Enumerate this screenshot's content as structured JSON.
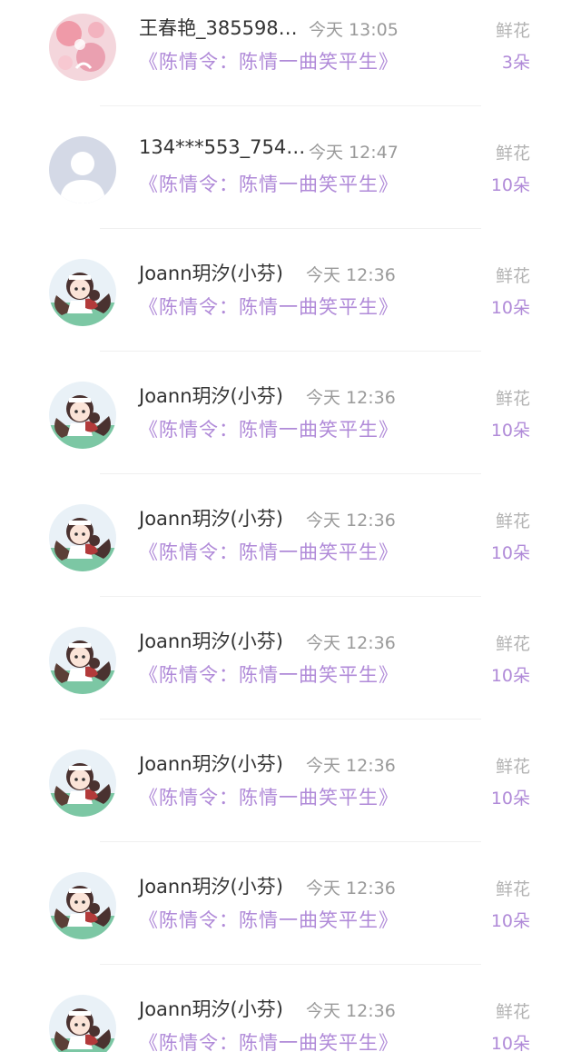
{
  "records": [
    {
      "user": "王春艳_385598…",
      "time": "今天 13:05",
      "book": "《陈情令：陈情一曲笑平生》",
      "gift": "鲜花",
      "count": "3朵",
      "avatar": "pink-floral-avatar"
    },
    {
      "user": "134***553_754…",
      "time": "今天 12:47",
      "book": "《陈情令：陈情一曲笑平生》",
      "gift": "鲜花",
      "count": "10朵",
      "avatar": "default-user-avatar"
    },
    {
      "user": "Joann玥汐(小芬)",
      "time": "今天 12:36",
      "book": "《陈情令：陈情一曲笑平生》",
      "gift": "鲜花",
      "count": "10朵",
      "avatar": "anime-character-avatar"
    },
    {
      "user": "Joann玥汐(小芬)",
      "time": "今天 12:36",
      "book": "《陈情令：陈情一曲笑平生》",
      "gift": "鲜花",
      "count": "10朵",
      "avatar": "anime-character-avatar"
    },
    {
      "user": "Joann玥汐(小芬)",
      "time": "今天 12:36",
      "book": "《陈情令：陈情一曲笑平生》",
      "gift": "鲜花",
      "count": "10朵",
      "avatar": "anime-character-avatar"
    },
    {
      "user": "Joann玥汐(小芬)",
      "time": "今天 12:36",
      "book": "《陈情令：陈情一曲笑平生》",
      "gift": "鲜花",
      "count": "10朵",
      "avatar": "anime-character-avatar"
    },
    {
      "user": "Joann玥汐(小芬)",
      "time": "今天 12:36",
      "book": "《陈情令：陈情一曲笑平生》",
      "gift": "鲜花",
      "count": "10朵",
      "avatar": "anime-character-avatar"
    },
    {
      "user": "Joann玥汐(小芬)",
      "time": "今天 12:36",
      "book": "《陈情令：陈情一曲笑平生》",
      "gift": "鲜花",
      "count": "10朵",
      "avatar": "anime-character-avatar"
    },
    {
      "user": "Joann玥汐(小芬)",
      "time": "今天 12:36",
      "book": "《陈情令：陈情一曲笑平生》",
      "gift": "鲜花",
      "count": "10朵",
      "avatar": "anime-character-avatar"
    }
  ],
  "colors": {
    "accent_purple": "#b08ad8",
    "name_text": "#333333",
    "secondary_text": "#9a9a9a"
  }
}
